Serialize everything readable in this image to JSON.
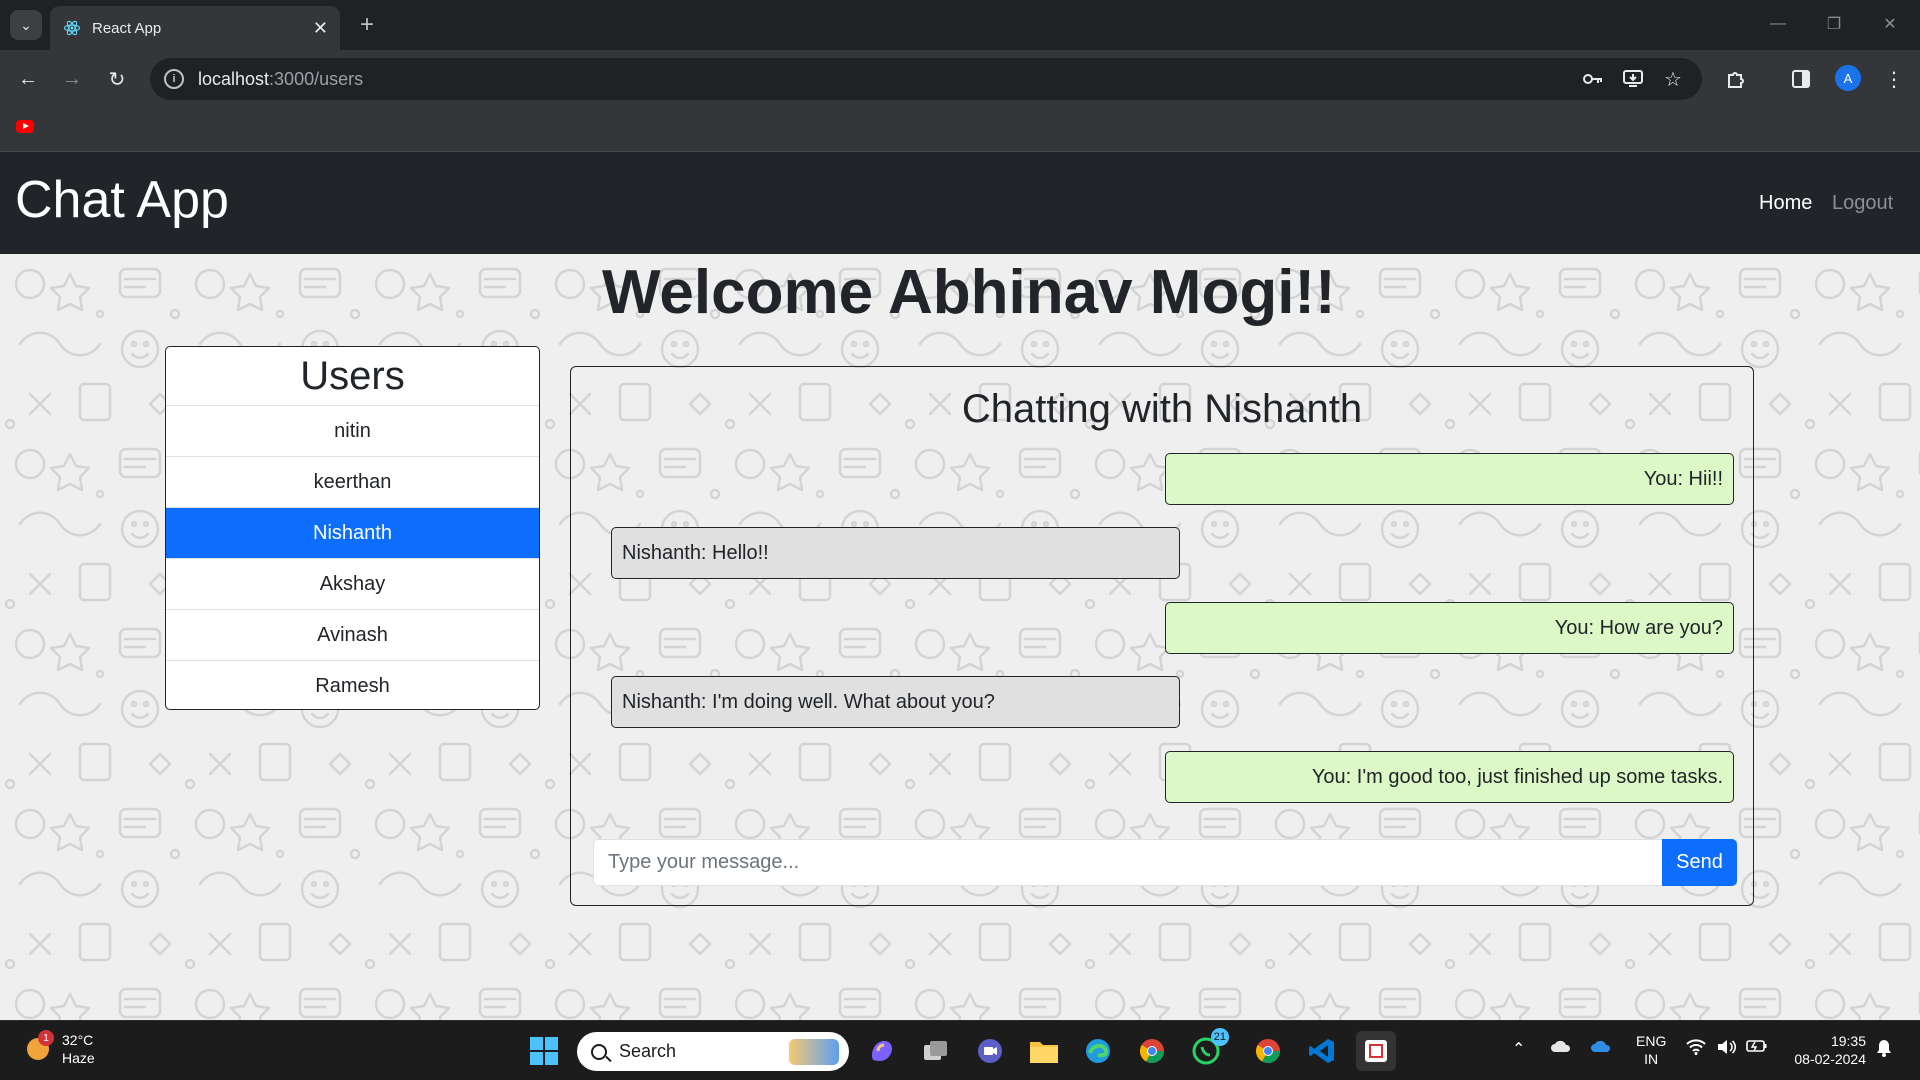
{
  "browser": {
    "tab_title": "React App",
    "tab_close": "✕",
    "new_tab": "+",
    "url_host": "localhost",
    "url_path": ":3000/users",
    "profile_initial": "A"
  },
  "navbar": {
    "brand": "Chat App",
    "links": {
      "home": "Home",
      "logout": "Logout"
    }
  },
  "welcome": "Welcome Abhinav Mogi!!",
  "users": {
    "title": "Users",
    "items": [
      {
        "name": "nitin"
      },
      {
        "name": "keerthan"
      },
      {
        "name": "Nishanth"
      },
      {
        "name": "Akshay"
      },
      {
        "name": "Avinash"
      },
      {
        "name": "Ramesh"
      }
    ],
    "selected": "Nishanth"
  },
  "chat": {
    "title": "Chatting with Nishanth",
    "messages": [
      {
        "sender": "you",
        "text": "You: Hii!!"
      },
      {
        "sender": "them",
        "text": "Nishanth: Hello!!"
      },
      {
        "sender": "you",
        "text": "You: How are you?"
      },
      {
        "sender": "them",
        "text": "Nishanth: I'm doing well. What about you?"
      },
      {
        "sender": "you",
        "text": "You: I'm good too, just finished up some tasks."
      }
    ],
    "input_placeholder": "Type your message...",
    "input_value": "",
    "send_label": "Send"
  },
  "taskbar": {
    "weather_temp": "32°C",
    "weather_desc": "Haze",
    "weather_badge": "1",
    "search_label": "Search",
    "whatsapp_badge": "21",
    "lang_primary": "ENG",
    "lang_secondary": "IN",
    "time": "19:35",
    "date": "08-02-2024"
  },
  "colors": {
    "navbar_bg": "#212529",
    "active_user": "#0d6efd",
    "bubble_you": "#dcf8c6",
    "bubble_them": "#e0e0e0",
    "send_button": "#0d6efd"
  }
}
